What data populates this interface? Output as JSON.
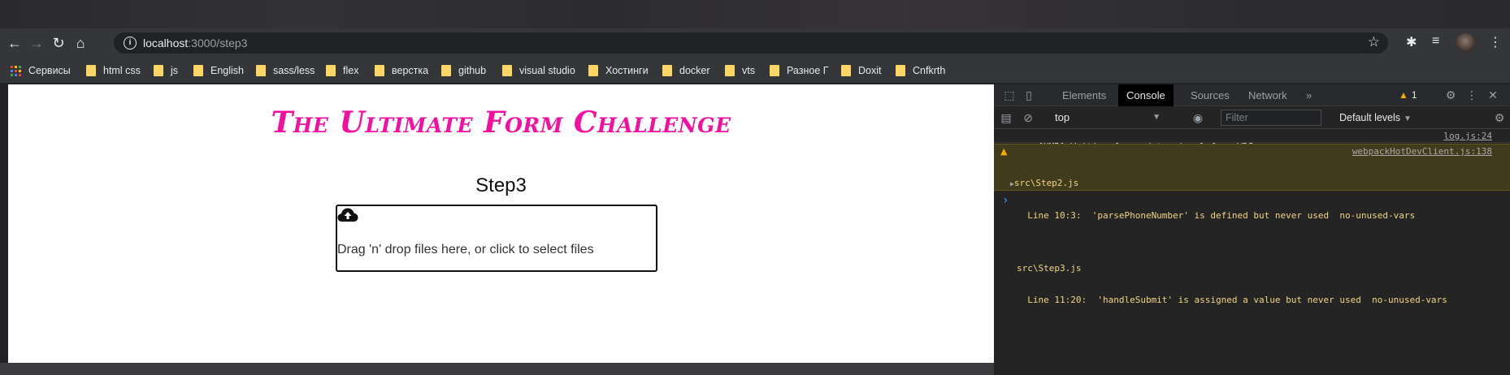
{
  "browser": {
    "url_host": "localhost",
    "url_rest": ":3000/step3",
    "nav": {
      "back": "←",
      "forward": "→",
      "reload": "↻",
      "home": "⌂"
    },
    "icons": [
      "info-icon",
      "star-icon",
      "extensions-icon",
      "media-icon",
      "menu-icon"
    ]
  },
  "bookmarks": [
    {
      "label": "Сервисы",
      "type": "apps"
    },
    {
      "label": "html css",
      "type": "folder"
    },
    {
      "label": "js",
      "type": "folder"
    },
    {
      "label": "English",
      "type": "folder"
    },
    {
      "label": "sass/less",
      "type": "folder"
    },
    {
      "label": "flex",
      "type": "folder"
    },
    {
      "label": "верстка",
      "type": "folder"
    },
    {
      "label": "github",
      "type": "folder"
    },
    {
      "label": "visual studio",
      "type": "folder"
    },
    {
      "label": "Хостинги",
      "type": "folder"
    },
    {
      "label": "docker",
      "type": "folder"
    },
    {
      "label": "vts",
      "type": "folder"
    },
    {
      "label": "Разное Г",
      "type": "folder"
    },
    {
      "label": "Doxit",
      "type": "folder"
    },
    {
      "label": "Cnfkrth",
      "type": "folder"
    }
  ],
  "page": {
    "title": "The Ultimate Form Challenge",
    "step": "Step3",
    "dropzone_text": "Drag 'n' drop files here, or click to select files"
  },
  "devtools": {
    "tabs": [
      "Elements",
      "Console",
      "Sources",
      "Network"
    ],
    "active_tab": "Console",
    "more": "»",
    "warning_count": "1",
    "context": "top",
    "filter_placeholder": "Filter",
    "levels": "Default levels",
    "messages": {
      "log_text": "[HMR] Waiting for update signal from WDS...",
      "log_src": "log.js:24",
      "warn_src": "webpackHotDevClient.js:138",
      "warn_lines": [
        "src\\Step2.js",
        "  Line 10:3:  'parsePhoneNumber' is defined but never used  no-unused-vars",
        "",
        "src\\Step3.js",
        "  Line 11:20:  'handleSubmit' is assigned a value but never used  no-unused-vars"
      ]
    },
    "prompt": "›"
  },
  "colors": {
    "title_pink": "#f50fa0",
    "warning_bg": "#413b1e",
    "warning_text": "#f2d586",
    "folder_yellow": "#fbd665"
  }
}
